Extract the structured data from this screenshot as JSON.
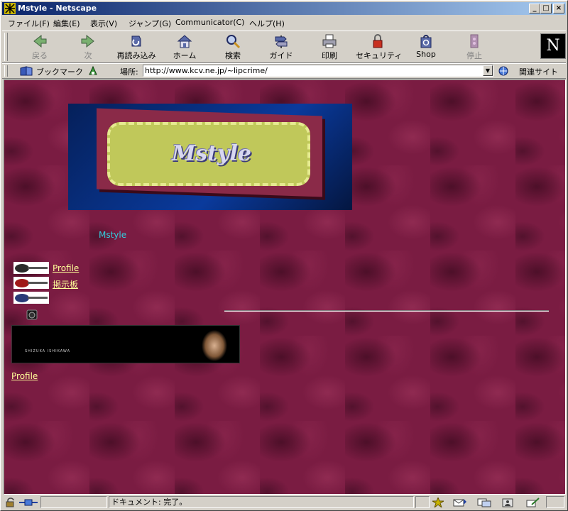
{
  "window": {
    "title": "Mstyle - Netscape",
    "controls": {
      "minimize": "_",
      "maximize": "□",
      "close": "×"
    }
  },
  "menu": [
    "ファイル(F)",
    "編集(E)",
    "表示(V)",
    "ジャンプ(G)",
    "Communicator(C)",
    "ヘルプ(H)"
  ],
  "toolbar": {
    "back": "戻る",
    "forward": "次",
    "reload": "再読み込み",
    "home": "ホーム",
    "search": "検索",
    "guide": "ガイド",
    "print": "印刷",
    "security": "セキュリティ",
    "shop": "Shop",
    "stop": "停止",
    "logo": "N"
  },
  "location": {
    "bookmarks": "ブックマーク",
    "location_label": "場所:",
    "url": "http://www.kcv.ne.jp/~lipcrime/",
    "related": "関連サイト"
  },
  "page": {
    "banner_logo": "Mstyle",
    "site_title": "Mstyle",
    "nav": [
      "Profile",
      "掲示板"
    ],
    "photo_caption": "SHIZUKA ISHIKAWA",
    "footer_link": "Profile"
  },
  "status": {
    "message": "ドキュメント: 完了。"
  },
  "colors": {
    "page_background": "#7a1c42",
    "link": "#ffff99",
    "title_text": "#33ccdd",
    "titlebar_start": "#0a246a",
    "titlebar_end": "#a6caf0"
  }
}
